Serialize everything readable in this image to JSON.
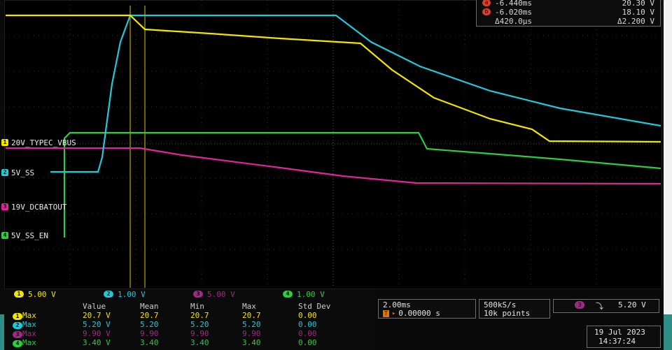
{
  "cursor_readout": {
    "row_a": {
      "time": "-6.440ms",
      "value": "20.30 V",
      "icon": "cursor-a"
    },
    "row_b": {
      "time": "-6.020ms",
      "value": "18.10 V",
      "icon": "cursor-b"
    },
    "row_delta": {
      "time": "Δ420.0µs",
      "value": "Δ2.200 V"
    }
  },
  "channel_labels": [
    {
      "id": "1",
      "name": "20V_TYPEC_VBUS",
      "color": "#f2e600"
    },
    {
      "id": "2",
      "name": "5V_SS",
      "color": "#22c8d8"
    },
    {
      "id": "3",
      "name": "19V_DCBATOUT",
      "color": "#e0259b"
    },
    {
      "id": "4",
      "name": "5V_SS_EN",
      "color": "#2ecc40"
    }
  ],
  "scales": [
    {
      "id": "1",
      "value": "5.00 V",
      "color": "#f2e600"
    },
    {
      "id": "2",
      "value": "1.00 V",
      "color": "#22c8d8"
    },
    {
      "id": "3",
      "value": "5.00 V",
      "color": "#9b2d80"
    },
    {
      "id": "4",
      "value": "1.00 V",
      "color": "#2ecc40"
    }
  ],
  "measurements": {
    "headers": [
      "Value",
      "Mean",
      "Min",
      "Max",
      "Std Dev"
    ],
    "rows": [
      {
        "id": "1",
        "label": "Max",
        "value": "20.7 V",
        "mean": "20.7",
        "min": "20.7",
        "max": "20.7",
        "std": "0.00",
        "color": "#f2e600"
      },
      {
        "id": "2",
        "label": "Max",
        "value": "5.20 V",
        "mean": "5.20",
        "min": "5.20",
        "max": "5.20",
        "std": "0.00",
        "color": "#22c8d8"
      },
      {
        "id": "3",
        "label": "Max",
        "value": "9.90 V",
        "mean": "9.90",
        "min": "9.90",
        "max": "9.90",
        "std": "0.00",
        "color": "#9b2d80"
      },
      {
        "id": "4",
        "label": "Max",
        "value": "3.40 V",
        "mean": "3.40",
        "min": "3.40",
        "max": "3.40",
        "std": "0.00",
        "color": "#2ecc40"
      }
    ]
  },
  "timebase": {
    "scale": "2.00ms",
    "position": "0.00000 s",
    "trigger_marker": "T"
  },
  "acquisition": {
    "sample_rate": "500kS/s",
    "record_length": "10k points"
  },
  "trigger": {
    "channel": "3",
    "slope_symbol": "⤵",
    "level": "5.20 V",
    "color": "#9b2d80"
  },
  "datetime": {
    "date": "19 Jul  2023",
    "time": "14:37:24"
  },
  "colors": {
    "ch1": "#f2e600",
    "ch2": "#22c8d8",
    "ch3": "#e0259b",
    "ch4": "#2ecc40",
    "cursor": "#c8b400",
    "background": "#000000"
  }
}
